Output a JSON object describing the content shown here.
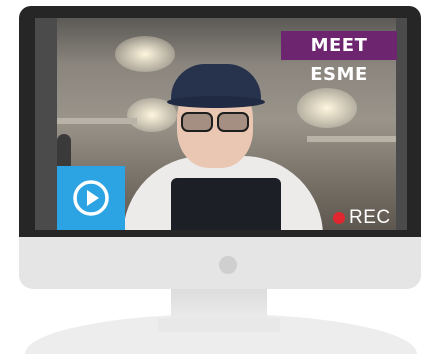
{
  "video": {
    "title_badge": "MEET ESME",
    "play_icon": "play-circle-icon",
    "recording": {
      "label": "REC",
      "icon": "record-dot-icon"
    }
  },
  "colors": {
    "bezel": "#262626",
    "chin": "#e5e5e5",
    "badge": "#6e2570",
    "play_tile": "#2ca3e2",
    "rec_dot": "#e0272f"
  }
}
